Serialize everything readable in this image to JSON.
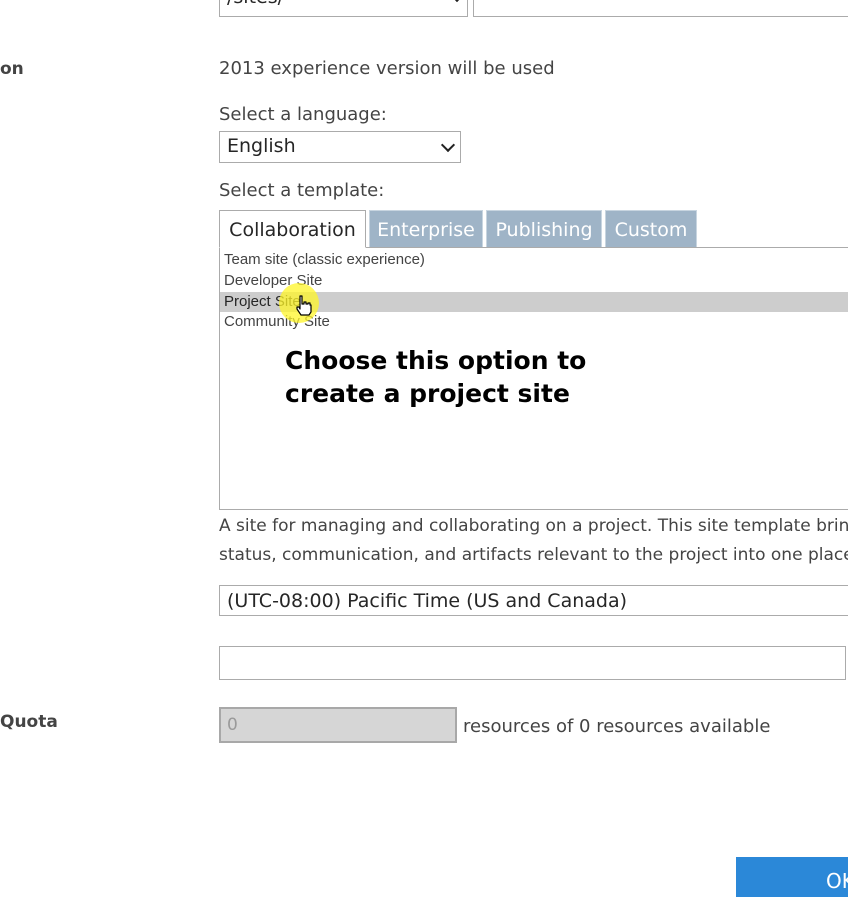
{
  "site_address": {
    "path_value": "/sites/"
  },
  "experience": {
    "section_label": "on",
    "version_text": "2013 experience version will be used"
  },
  "language": {
    "prompt": "Select a language:",
    "selected": "English"
  },
  "template": {
    "prompt": "Select a template:",
    "tabs": [
      {
        "label": "Collaboration",
        "active": true
      },
      {
        "label": "Enterprise",
        "active": false
      },
      {
        "label": "Publishing",
        "active": false
      },
      {
        "label": "Custom",
        "active": false
      }
    ],
    "items": [
      {
        "label": "Team site (classic experience)",
        "selected": false
      },
      {
        "label": "Developer Site",
        "selected": false
      },
      {
        "label": "Project Site",
        "selected": true
      },
      {
        "label": "Community Site",
        "selected": false
      }
    ],
    "callout_line1": "Choose this option to",
    "callout_line2": "create a project site",
    "description_line1": "A site for managing and collaborating on a project. This site template brin",
    "description_line2": "status, communication, and artifacts relevant to the project into one place"
  },
  "time_zone": {
    "selected": "(UTC-08:00) Pacific Time (US and Canada)"
  },
  "admin": {
    "value": ""
  },
  "quota": {
    "section_label": "Quota",
    "value": "0",
    "suffix": "resources of 0 resources available"
  },
  "actions": {
    "ok_label": "OK"
  },
  "colors": {
    "tab_inactive": "#9fb4c7",
    "selected_row": "#cdcdcd",
    "ok_button": "#2b88d8",
    "cursor_highlight": "#fff528"
  }
}
